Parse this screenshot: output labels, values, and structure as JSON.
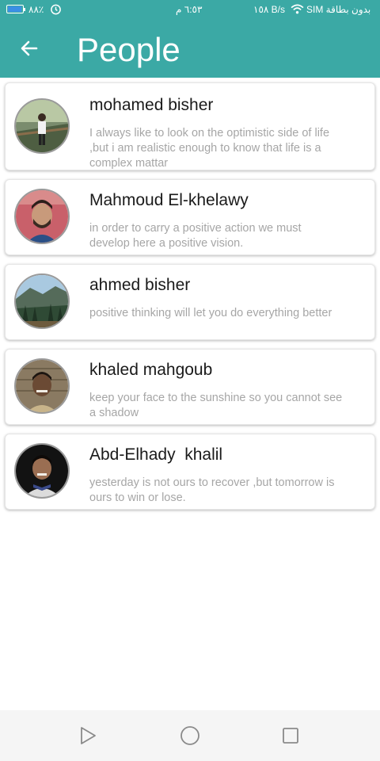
{
  "status_bar": {
    "battery_percent": "٨٨٪",
    "time": "٦:٥٣ م",
    "net_speed": "١٥٨ B/s",
    "carrier": "SIM بدون بطاقة"
  },
  "app_bar": {
    "title": "People"
  },
  "people": [
    {
      "name": "mohamed bisher",
      "quote": "I always like to look on the optimistic side of life ,but i am realistic enough to know that life is a complex mattar"
    },
    {
      "name": "Mahmoud El-khelawy",
      "quote": "in order to carry a positive action we must develop here a positive vision."
    },
    {
      "name": "ahmed bisher",
      "quote": "positive thinking will let you do everything better"
    },
    {
      "name": "khaled mahgoub",
      "quote": "keep your face to the sunshine so you cannot see  a shadow"
    },
    {
      "name": "Abd-Elhady  khalil",
      "quote": "yesterday is not ours to recover ,but tomorrow is ours to win or lose."
    }
  ],
  "colors": {
    "primary": "#3ba9a5",
    "name_text": "#1a1a1a",
    "quote_text": "#a6a6a6"
  }
}
